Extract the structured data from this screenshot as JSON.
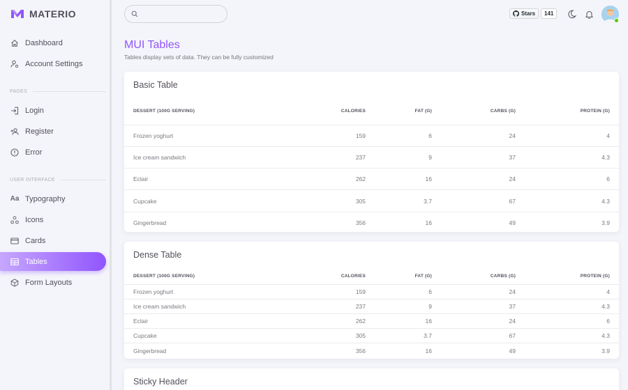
{
  "brand": {
    "name": "MATERIO",
    "color": "#9155fd"
  },
  "nav": {
    "items": [
      {
        "label": "Dashboard",
        "icon": "home-icon"
      },
      {
        "label": "Account Settings",
        "icon": "account-cog-icon"
      }
    ],
    "sections": [
      {
        "title": "PAGES",
        "items": [
          {
            "label": "Login",
            "icon": "login-icon"
          },
          {
            "label": "Register",
            "icon": "account-plus-icon"
          },
          {
            "label": "Error",
            "icon": "alert-circle-icon"
          }
        ]
      },
      {
        "title": "USER INTERFACE",
        "items": [
          {
            "label": "Typography",
            "icon": "format-letter-case-icon"
          },
          {
            "label": "Icons",
            "icon": "google-circles-extended-icon"
          },
          {
            "label": "Cards",
            "icon": "credit-card-icon"
          },
          {
            "label": "Tables",
            "icon": "table-icon",
            "active": true
          },
          {
            "label": "Form Layouts",
            "icon": "cube-outline-icon"
          }
        ]
      }
    ]
  },
  "topbar": {
    "search_placeholder": "",
    "github": {
      "label": "Stars",
      "count": "141"
    }
  },
  "page": {
    "title": "MUI Tables",
    "subtitle": "Tables display sets of data. They can be fully customized"
  },
  "table_columns": [
    "DESSERT (100G SERVING)",
    "CALORIES",
    "FAT (G)",
    "CARBS (G)",
    "PROTEIN (G)"
  ],
  "table_rows": [
    [
      "Frozen yoghurt",
      "159",
      "6",
      "24",
      "4"
    ],
    [
      "Ice cream sandwich",
      "237",
      "9",
      "37",
      "4.3"
    ],
    [
      "Eclair",
      "262",
      "16",
      "24",
      "6"
    ],
    [
      "Cupcake",
      "305",
      "3.7",
      "67",
      "4.3"
    ],
    [
      "Gingerbread",
      "356",
      "16",
      "49",
      "3.9"
    ]
  ],
  "cards": {
    "basic_title": "Basic Table",
    "dense_title": "Dense Table",
    "sticky_title": "Sticky Header"
  }
}
